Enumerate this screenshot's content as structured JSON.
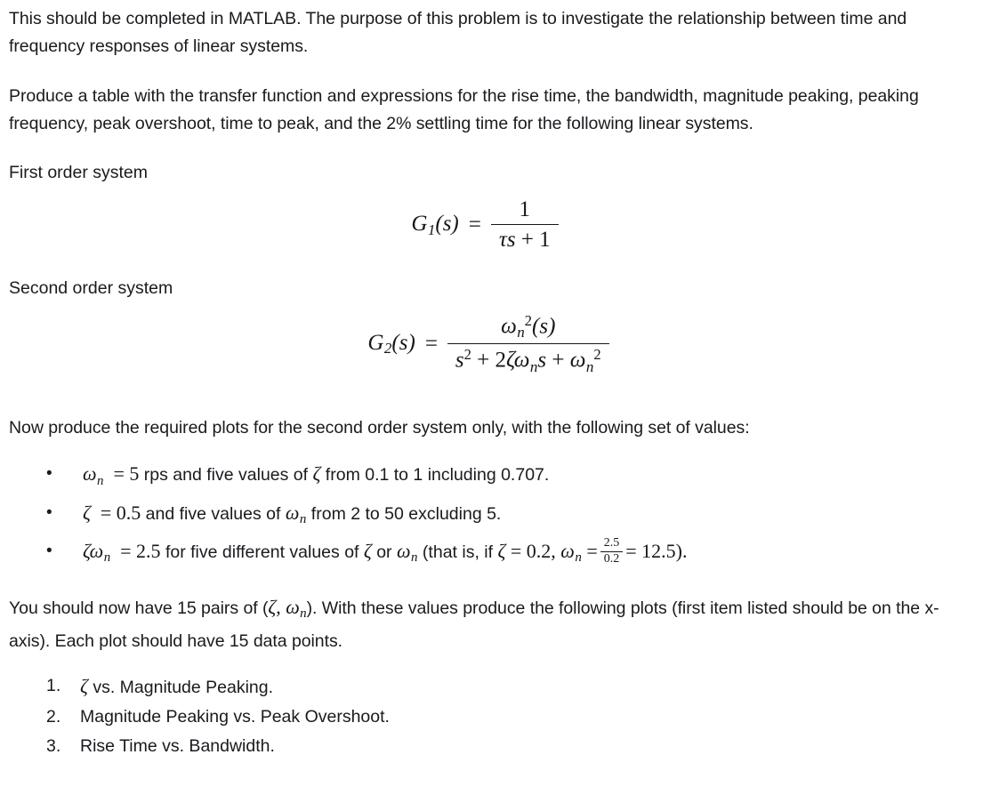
{
  "document": {
    "paragraphs": {
      "intro": "This should be completed in MATLAB. The purpose of this problem is to investigate the relationship between time and frequency responses of linear systems.",
      "task": "Produce a table with the transfer function and expressions for the rise time, the bandwidth, magnitude peaking, peaking frequency, peak overshoot, time to peak, and the 2% settling time for the following linear systems.",
      "plots_intro": "Now produce the required plots for the second order system only, with the following set of values:",
      "pairs_note": {
        "before": "You should now have 15 pairs of  (",
        "zeta": "ζ",
        "comma": ", ",
        "omega": "ω",
        "omega_sub": "n",
        "after": "). With these values produce the following plots (first item listed should be on the x-axis). Each plot should have 15 data points."
      }
    },
    "headings": {
      "first_order": "First order system",
      "second_order": "Second order system"
    },
    "equations": {
      "first_order": {
        "lhs_G": "G",
        "lhs_sub": "1",
        "lhs_arg": "(s)",
        "equals": "=",
        "numerator": "1",
        "denominator_tau": "τ",
        "denominator_s": "s",
        "denominator_rest": "+ 1"
      },
      "second_order": {
        "lhs_G": "G",
        "lhs_sub": "2",
        "lhs_arg": "(s)",
        "equals": "=",
        "num_omega": "ω",
        "num_sub": "n",
        "num_sup": "2",
        "num_arg": "(s)",
        "den_s": "s",
        "den_s_sup": "2",
        "den_plus1": "+ 2",
        "den_zeta": "ζ",
        "den_omega": "ω",
        "den_omega_sub": "n",
        "den_s2": "s",
        "den_plus2": "+",
        "den_omega2": "ω",
        "den_omega2_sub": "n",
        "den_omega2_sup": "2"
      }
    },
    "bullets": {
      "marker": "•",
      "items": [
        {
          "symbol": "ω",
          "symbol_sub": "n",
          "equals": "=",
          "value": "5",
          "text": " rps and five values of ",
          "symbol2": "ζ",
          "text2": " from 0.1 to 1 including 0.707."
        },
        {
          "symbol": "ζ",
          "equals": "=",
          "value": "0.5",
          "text": " and five values of ",
          "symbol2": "ω",
          "symbol2_sub": "n",
          "text2": " from 2 to 50 excluding 5."
        },
        {
          "symbol": "ζ",
          "symbol_omega": "ω",
          "symbol_omega_sub": "n",
          "equals": "=",
          "value": "2.5",
          "text": " for five different values of ",
          "symbol2": "ζ",
          "text_or": " or ",
          "symbol3": "ω",
          "symbol3_sub": "n",
          "text2": " (that is, if ",
          "symbol4": "ζ",
          "equals2": "=",
          "value2": "0.2, ",
          "symbol5": "ω",
          "symbol5_sub": "n",
          "equals3": "=",
          "frac_num": "2.5",
          "frac_den": "0.2",
          "equals4": "=",
          "value3": "12.5)."
        }
      ]
    },
    "numbered_list": {
      "items": [
        {
          "ordinal": "1.",
          "symbol": "ζ",
          "text": " vs. Magnitude Peaking."
        },
        {
          "ordinal": "2.",
          "text": "Magnitude Peaking vs. Peak Overshoot."
        },
        {
          "ordinal": "3.",
          "text": "Rise Time vs. Bandwidth."
        }
      ]
    }
  }
}
